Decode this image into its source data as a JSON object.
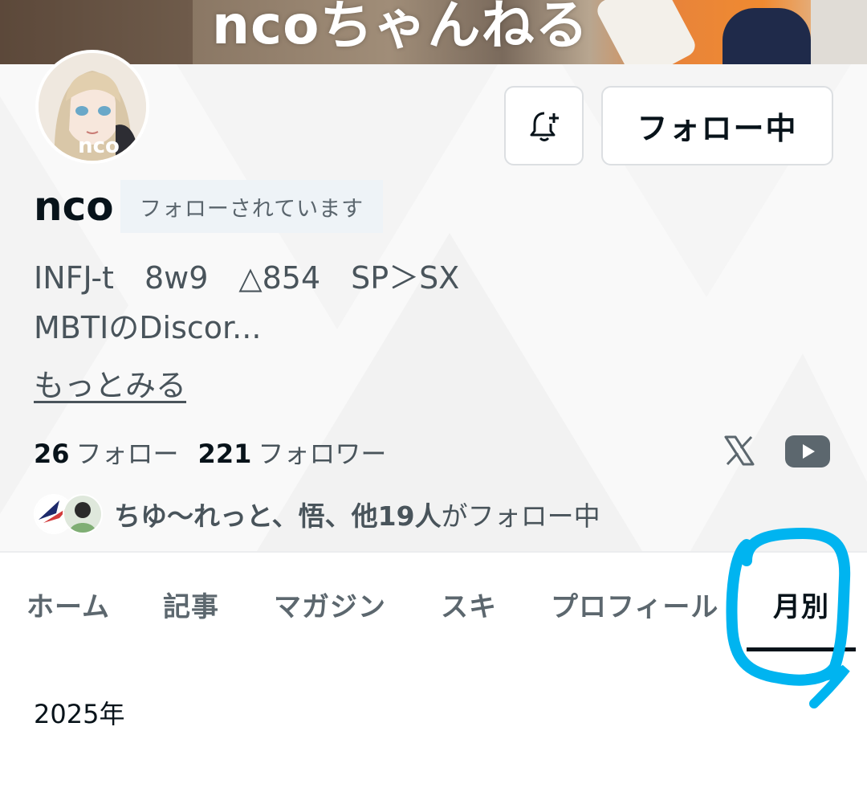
{
  "cover": {
    "title": "ncoちゃんねる"
  },
  "profile": {
    "avatar_text": "nco",
    "username": "nco",
    "followed_badge": "フォローされています",
    "bio_line1": "INFJ-t　8w9　△854　SP＞SX",
    "bio_line2": "MBTIのDiscor...",
    "more_label": "もっとみる"
  },
  "actions": {
    "follow_label": "フォロー中",
    "bell_icon": "bell-plus-icon"
  },
  "stats": {
    "following_count": "26",
    "following_label": "フォロー",
    "followers_count": "221",
    "followers_label": "フォロワー"
  },
  "social": {
    "x_icon": "x-icon",
    "youtube_icon": "youtube-icon"
  },
  "mutual": {
    "names": "ちゆ〜れっと、悟、他19人",
    "suffix": "がフォロー中"
  },
  "tabs": [
    {
      "label": "ホーム"
    },
    {
      "label": "記事"
    },
    {
      "label": "マガジン"
    },
    {
      "label": "スキ"
    },
    {
      "label": "プロフィール"
    },
    {
      "label": "月別",
      "active": true
    }
  ],
  "content": {
    "year": "2025年"
  },
  "colors": {
    "annotation": "#00b4f0",
    "text": "#08131a",
    "muted": "#49545b"
  }
}
